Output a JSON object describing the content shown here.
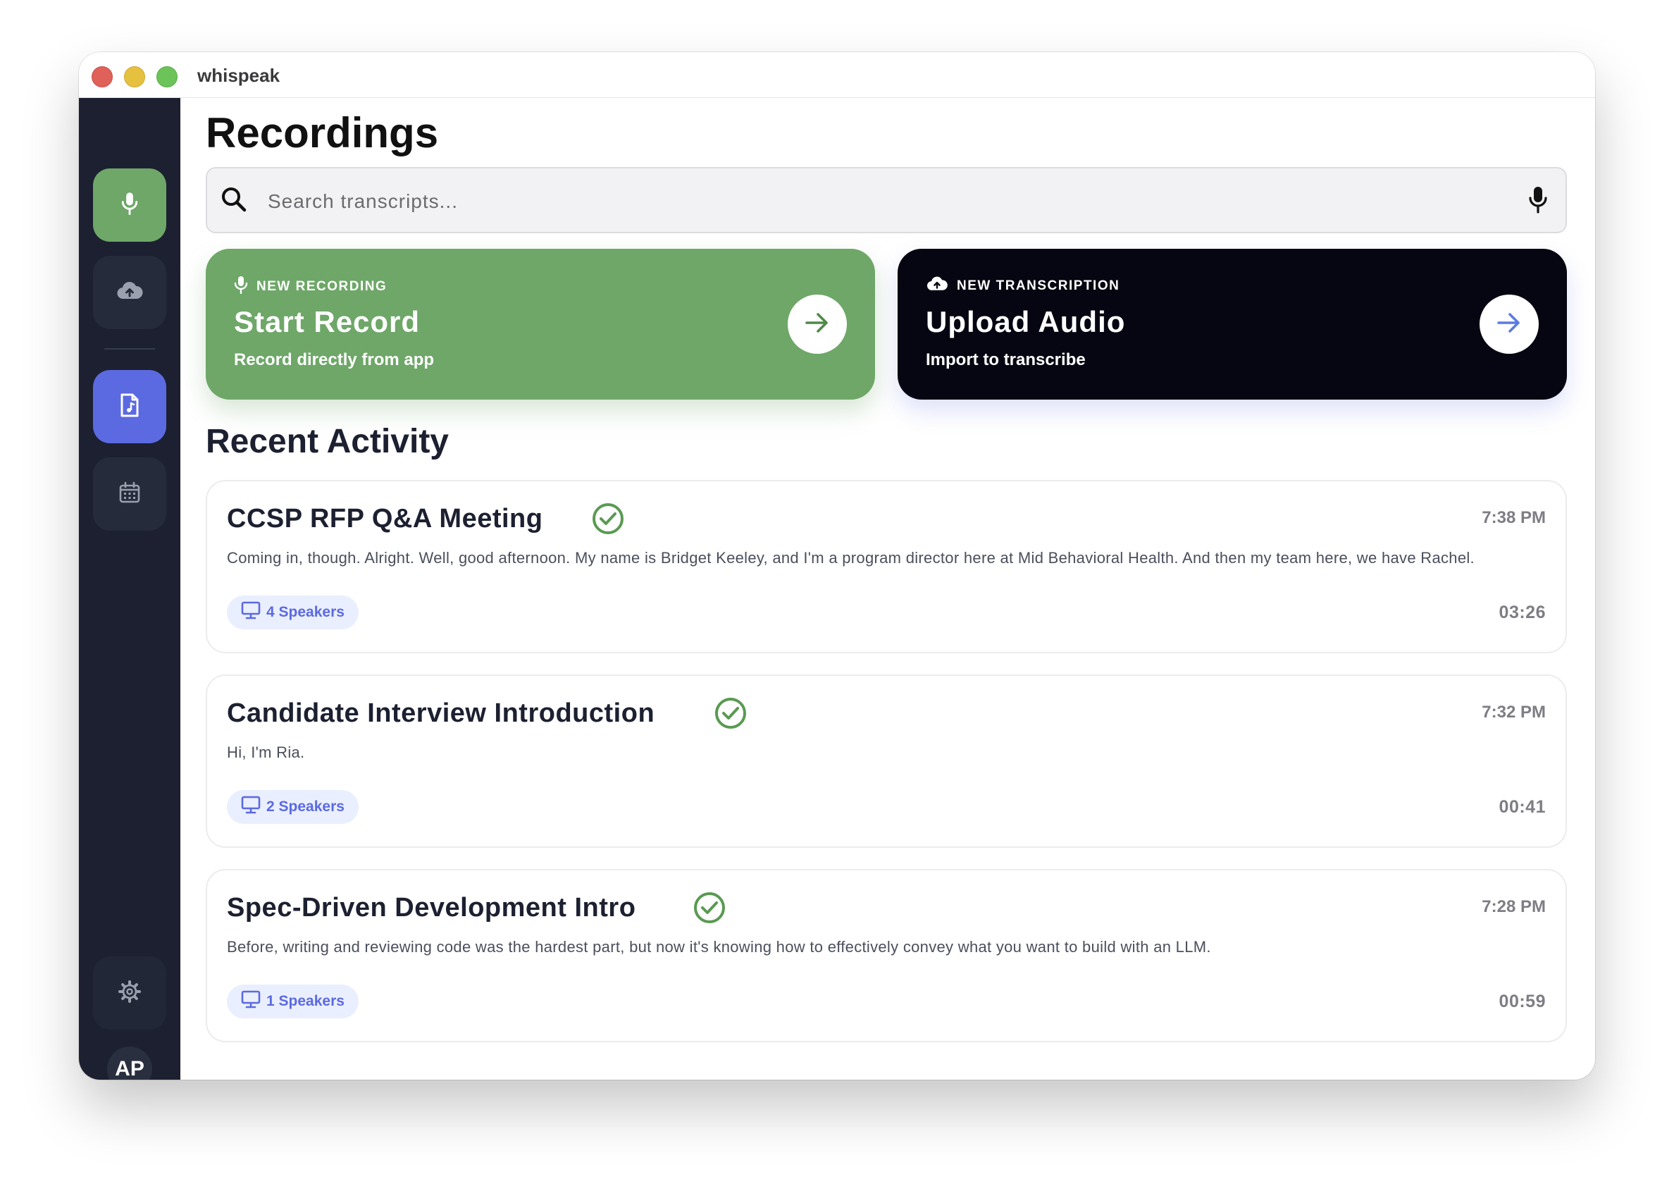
{
  "window": {
    "title": "whispeak"
  },
  "sidebar": {
    "items": [
      {
        "name": "record",
        "icon": "microphone-icon",
        "active": true,
        "color": "#6ea768"
      },
      {
        "name": "upload",
        "icon": "cloud-upload-icon"
      },
      {
        "name": "documents",
        "icon": "file-audio-icon",
        "active": true,
        "color": "#5b6ae0"
      },
      {
        "name": "calendar",
        "icon": "calendar-icon"
      },
      {
        "name": "settings",
        "icon": "gear-icon"
      }
    ],
    "avatar_initials": "AP"
  },
  "main": {
    "title": "Recordings",
    "search": {
      "placeholder": "Search transcripts..."
    },
    "cards": [
      {
        "kicker": "NEW RECORDING",
        "title": "Start Record",
        "subtitle": "Record directly from app",
        "color": "#6ea768"
      },
      {
        "kicker": "NEW TRANSCRIPTION",
        "title": "Upload Audio",
        "subtitle": "Import to transcribe",
        "color": "#060612"
      }
    ],
    "recent_title": "Recent Activity",
    "recent": [
      {
        "title": "CCSP RFP Q&A Meeting",
        "time": "7:38 PM",
        "snippet": "Coming in, though. Alright. Well, good afternoon. My name is Bridget Keeley, and I'm a program director here at Mid Behavioral Health. And then my team here, we have Rachel.",
        "speakers": "4 Speakers",
        "duration": "03:26",
        "status": "completed"
      },
      {
        "title": "Candidate Interview Introduction",
        "time": "7:32 PM",
        "snippet": "Hi, I'm Ria.",
        "speakers": "2 Speakers",
        "duration": "00:41",
        "status": "completed"
      },
      {
        "title": "Spec-Driven Development Intro",
        "time": "7:28 PM",
        "snippet": "Before, writing and reviewing code was the hardest part, but now it's knowing how to effectively convey what you want to build with an LLM.",
        "speakers": "1 Speakers",
        "duration": "00:59",
        "status": "completed"
      }
    ]
  },
  "colors": {
    "accent_green": "#6ea768",
    "accent_indigo": "#5b6ae0",
    "sidebar_bg": "#1c2030",
    "check_green": "#5a9a52"
  }
}
